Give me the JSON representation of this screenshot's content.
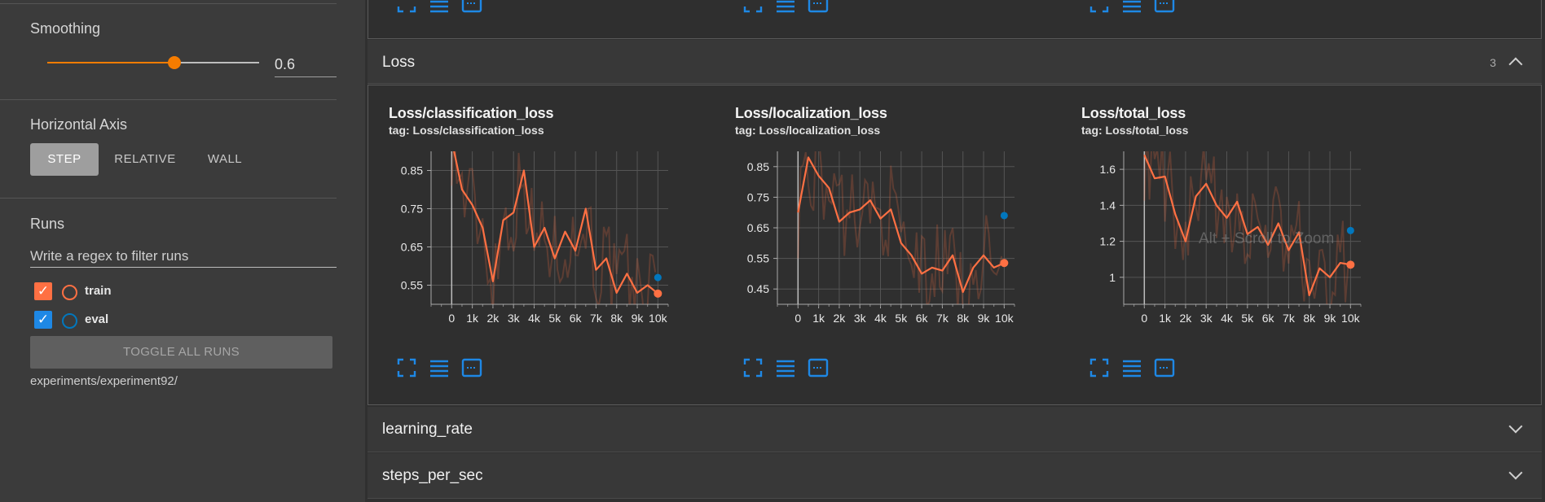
{
  "sidebar": {
    "smoothing": {
      "label": "Smoothing",
      "value": "0.6",
      "level": 0.6
    },
    "horizontal_axis": {
      "label": "Horizontal Axis",
      "options": [
        "STEP",
        "RELATIVE",
        "WALL"
      ],
      "selected": "STEP"
    },
    "runs": {
      "label": "Runs",
      "filter_placeholder": "Write a regex to filter runs",
      "items": [
        {
          "name": "train",
          "checked": true,
          "color": "#ff7043",
          "check_color": "#ff7043"
        },
        {
          "name": "eval",
          "checked": true,
          "color": "#0277bd",
          "check_color": "#1e88e5"
        }
      ],
      "toggle_all_label": "TOGGLE ALL RUNS",
      "experiment_path": "experiments/experiment92/"
    }
  },
  "main": {
    "loss_section": {
      "title": "Loss",
      "count": "3",
      "charts": [
        {
          "title": "Loss/classification_loss",
          "tag": "tag: Loss/classification_loss"
        },
        {
          "title": "Loss/localization_loss",
          "tag": "tag: Loss/localization_loss"
        },
        {
          "title": "Loss/total_loss",
          "tag": "tag: Loss/total_loss"
        }
      ],
      "watermark": "Alt + Scroll to Zoom"
    },
    "collapsed_sections": [
      {
        "title": "learning_rate"
      },
      {
        "title": "steps_per_sec"
      }
    ]
  },
  "chart_data": [
    {
      "type": "line",
      "title": "Loss/classification_loss",
      "xlabel": "",
      "ylabel": "",
      "xlim": [
        -1000,
        10500
      ],
      "ylim": [
        0.5,
        0.9
      ],
      "x_ticks": [
        "0",
        "1k",
        "2k",
        "3k",
        "4k",
        "5k",
        "6k",
        "7k",
        "8k",
        "9k",
        "10k"
      ],
      "y_ticks": [
        "0.55",
        "0.65",
        "0.75",
        "0.85"
      ],
      "grid": true,
      "series": [
        {
          "name": "train",
          "color": "#ff7043",
          "x": [
            0,
            500,
            1000,
            1500,
            2000,
            2500,
            3000,
            3500,
            4000,
            4500,
            5000,
            5500,
            6000,
            6500,
            7000,
            7500,
            8000,
            8500,
            9000,
            9500,
            10000
          ],
          "y": [
            0.93,
            0.8,
            0.76,
            0.7,
            0.56,
            0.72,
            0.74,
            0.85,
            0.65,
            0.7,
            0.62,
            0.69,
            0.64,
            0.75,
            0.59,
            0.62,
            0.53,
            0.58,
            0.53,
            0.55,
            0.528
          ]
        },
        {
          "name": "eval",
          "color": "#0277bd",
          "x": [
            10000
          ],
          "y": [
            0.57
          ]
        }
      ]
    },
    {
      "type": "line",
      "title": "Loss/localization_loss",
      "xlabel": "",
      "ylabel": "",
      "xlim": [
        -1000,
        10500
      ],
      "ylim": [
        0.4,
        0.9
      ],
      "x_ticks": [
        "0",
        "1k",
        "2k",
        "3k",
        "4k",
        "5k",
        "6k",
        "7k",
        "8k",
        "9k",
        "10k"
      ],
      "y_ticks": [
        "0.45",
        "0.55",
        "0.65",
        "0.75",
        "0.85"
      ],
      "grid": true,
      "series": [
        {
          "name": "train",
          "color": "#ff7043",
          "x": [
            0,
            500,
            1000,
            1500,
            2000,
            2500,
            3000,
            3500,
            4000,
            4500,
            5000,
            5500,
            6000,
            6500,
            7000,
            7500,
            8000,
            8500,
            9000,
            9500,
            10000
          ],
          "y": [
            0.7,
            0.88,
            0.82,
            0.78,
            0.67,
            0.7,
            0.71,
            0.74,
            0.68,
            0.71,
            0.6,
            0.56,
            0.5,
            0.52,
            0.51,
            0.56,
            0.44,
            0.52,
            0.56,
            0.52,
            0.535
          ]
        },
        {
          "name": "eval",
          "color": "#0277bd",
          "x": [
            10000
          ],
          "y": [
            0.69
          ]
        }
      ]
    },
    {
      "type": "line",
      "title": "Loss/total_loss",
      "xlabel": "",
      "ylabel": "",
      "xlim": [
        -1000,
        10500
      ],
      "ylim": [
        0.85,
        1.7
      ],
      "x_ticks": [
        "0",
        "1k",
        "2k",
        "3k",
        "4k",
        "5k",
        "6k",
        "7k",
        "8k",
        "9k",
        "10k"
      ],
      "y_ticks": [
        "1",
        "1.2",
        "1.4",
        "1.6"
      ],
      "grid": true,
      "series": [
        {
          "name": "train",
          "color": "#ff7043",
          "x": [
            0,
            500,
            1000,
            1500,
            2000,
            2500,
            3000,
            3500,
            4000,
            4500,
            5000,
            5500,
            6000,
            6500,
            7000,
            7500,
            8000,
            8500,
            9000,
            9500,
            10000
          ],
          "y": [
            1.68,
            1.55,
            1.56,
            1.35,
            1.2,
            1.45,
            1.52,
            1.4,
            1.33,
            1.42,
            1.24,
            1.28,
            1.18,
            1.3,
            1.15,
            1.25,
            0.9,
            1.05,
            1.0,
            1.08,
            1.07
          ]
        },
        {
          "name": "eval",
          "color": "#0277bd",
          "x": [
            10000
          ],
          "y": [
            1.26
          ]
        }
      ]
    }
  ]
}
